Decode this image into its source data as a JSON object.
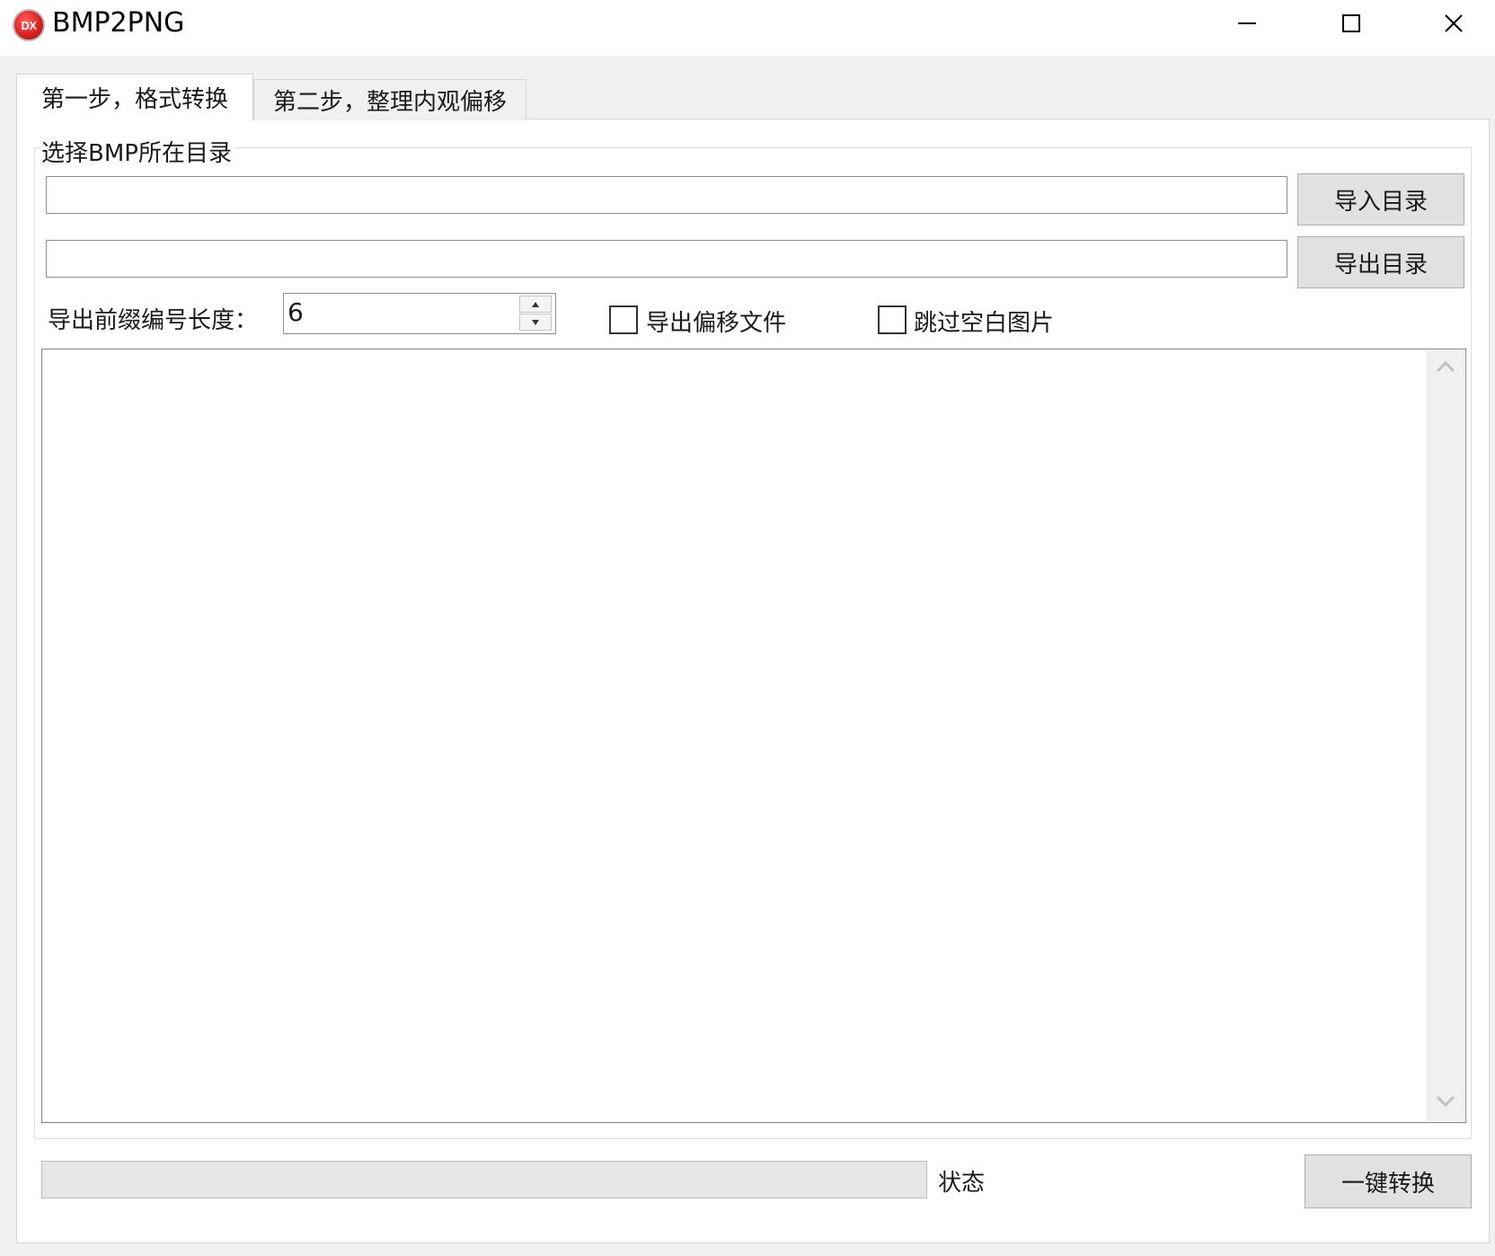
{
  "window": {
    "title": "BMP2PNG",
    "icon_text": "DX",
    "icon_color": "#d81e1e"
  },
  "tabs": [
    {
      "label": "第一步，格式转换",
      "active": true
    },
    {
      "label": "第二步，整理内观偏移",
      "active": false
    }
  ],
  "group": {
    "legend_prefix": "选择",
    "legend_latin": "BMP",
    "legend_suffix": "所在目录"
  },
  "import_dir": {
    "value": "",
    "button_label": "导入目录"
  },
  "export_dir": {
    "value": "",
    "button_label": "导出目录"
  },
  "prefix_length": {
    "label": "导出前缀编号长度：",
    "value": "6"
  },
  "options": {
    "export_offset": {
      "label": "导出偏移文件",
      "checked": false
    },
    "skip_blank": {
      "label": "跳过空白图片",
      "checked": false
    }
  },
  "log": {
    "content": ""
  },
  "status": {
    "label": "状态",
    "progress": 0,
    "progress_color": "#06b025"
  },
  "convert_button": {
    "label": "一键转换"
  }
}
